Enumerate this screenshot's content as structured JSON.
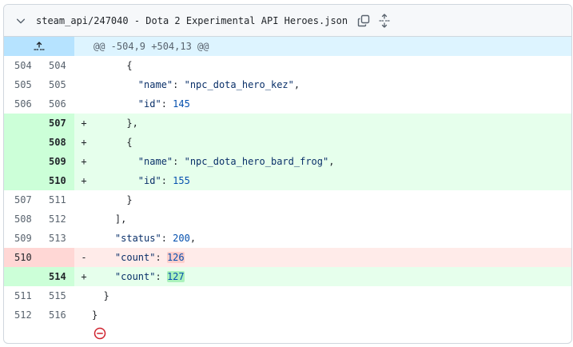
{
  "file": {
    "name": "steam_api/247040 - Dota 2 Experimental API Heroes.json",
    "icons": {
      "collapse": "chevron-down-icon",
      "copy": "copy-icon",
      "expand": "unfold-icon"
    }
  },
  "hunk": {
    "header": "@@ -504,9 +504,13 @@",
    "icon": "expand-up-icon"
  },
  "lines": [
    {
      "type": "ctx",
      "old": "504",
      "new": "504",
      "sign": "",
      "indent": "      ",
      "parts": [
        {
          "t": "{",
          "c": ""
        }
      ]
    },
    {
      "type": "ctx",
      "old": "505",
      "new": "505",
      "sign": "",
      "indent": "        ",
      "parts": [
        {
          "t": "\"name\"",
          "c": "str"
        },
        {
          "t": ": ",
          "c": ""
        },
        {
          "t": "\"npc_dota_hero_kez\"",
          "c": "str"
        },
        {
          "t": ",",
          "c": ""
        }
      ]
    },
    {
      "type": "ctx",
      "old": "506",
      "new": "506",
      "sign": "",
      "indent": "        ",
      "parts": [
        {
          "t": "\"id\"",
          "c": "str"
        },
        {
          "t": ": ",
          "c": ""
        },
        {
          "t": "145",
          "c": "num"
        }
      ]
    },
    {
      "type": "add",
      "old": "",
      "new": "507",
      "sign": "+",
      "indent": "      ",
      "parts": [
        {
          "t": "},",
          "c": ""
        }
      ]
    },
    {
      "type": "add",
      "old": "",
      "new": "508",
      "sign": "+",
      "indent": "      ",
      "parts": [
        {
          "t": "{",
          "c": ""
        }
      ]
    },
    {
      "type": "add",
      "old": "",
      "new": "509",
      "sign": "+",
      "indent": "        ",
      "parts": [
        {
          "t": "\"name\"",
          "c": "str"
        },
        {
          "t": ": ",
          "c": ""
        },
        {
          "t": "\"npc_dota_hero_bard_frog\"",
          "c": "str"
        },
        {
          "t": ",",
          "c": ""
        }
      ]
    },
    {
      "type": "add",
      "old": "",
      "new": "510",
      "sign": "+",
      "indent": "        ",
      "parts": [
        {
          "t": "\"id\"",
          "c": "str"
        },
        {
          "t": ": ",
          "c": ""
        },
        {
          "t": "155",
          "c": "num"
        }
      ]
    },
    {
      "type": "ctx",
      "old": "507",
      "new": "511",
      "sign": "",
      "indent": "      ",
      "parts": [
        {
          "t": "}",
          "c": ""
        }
      ]
    },
    {
      "type": "ctx",
      "old": "508",
      "new": "512",
      "sign": "",
      "indent": "    ",
      "parts": [
        {
          "t": "],",
          "c": ""
        }
      ]
    },
    {
      "type": "ctx",
      "old": "509",
      "new": "513",
      "sign": "",
      "indent": "    ",
      "parts": [
        {
          "t": "\"status\"",
          "c": "str"
        },
        {
          "t": ": ",
          "c": ""
        },
        {
          "t": "200",
          "c": "num"
        },
        {
          "t": ",",
          "c": ""
        }
      ]
    },
    {
      "type": "del",
      "old": "510",
      "new": "",
      "sign": "-",
      "indent": "    ",
      "parts": [
        {
          "t": "\"count\"",
          "c": "str"
        },
        {
          "t": ": ",
          "c": ""
        },
        {
          "t": "126",
          "c": "num hl-del"
        }
      ]
    },
    {
      "type": "add",
      "old": "",
      "new": "514",
      "sign": "+",
      "indent": "    ",
      "parts": [
        {
          "t": "\"count\"",
          "c": "str"
        },
        {
          "t": ": ",
          "c": ""
        },
        {
          "t": "127",
          "c": "num hl-add"
        }
      ]
    },
    {
      "type": "ctx",
      "old": "511",
      "new": "515",
      "sign": "",
      "indent": "  ",
      "parts": [
        {
          "t": "}",
          "c": ""
        }
      ]
    },
    {
      "type": "ctx",
      "old": "512",
      "new": "516",
      "sign": "",
      "indent": "",
      "parts": [
        {
          "t": "}",
          "c": ""
        }
      ]
    }
  ],
  "footer": {
    "icon": "no-newline-minus-icon"
  },
  "colors": {
    "add_bg": "#e6ffec",
    "add_gutter": "#ccffd8",
    "del_bg": "#ffebe9",
    "del_gutter": "#ffd7d5",
    "hunk_bg": "#ddf4ff",
    "hunk_gutter": "#b6e3ff",
    "error_red": "#cf222e"
  }
}
